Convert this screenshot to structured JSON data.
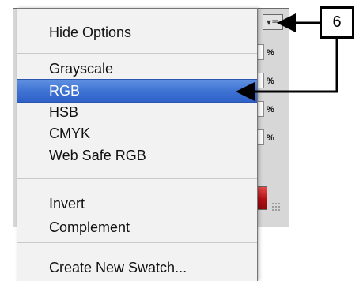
{
  "panel": {
    "menu_button_icon": "panel-menu-icon",
    "percent_labels": [
      "%",
      "%",
      "%",
      "%"
    ]
  },
  "menu": {
    "items": [
      {
        "label": "Hide Options"
      },
      {
        "label": "Grayscale"
      },
      {
        "label": "RGB",
        "selected": true
      },
      {
        "label": "HSB"
      },
      {
        "label": "CMYK"
      },
      {
        "label": "Web Safe RGB"
      },
      {
        "label": "Invert"
      },
      {
        "label": "Complement"
      },
      {
        "label": "Create New Swatch..."
      }
    ]
  },
  "callout": {
    "number": "6"
  },
  "colors": {
    "selection": "#3d71d2",
    "menu_bg": "#f2f2f2",
    "panel_bg": "#d7d7d7"
  }
}
